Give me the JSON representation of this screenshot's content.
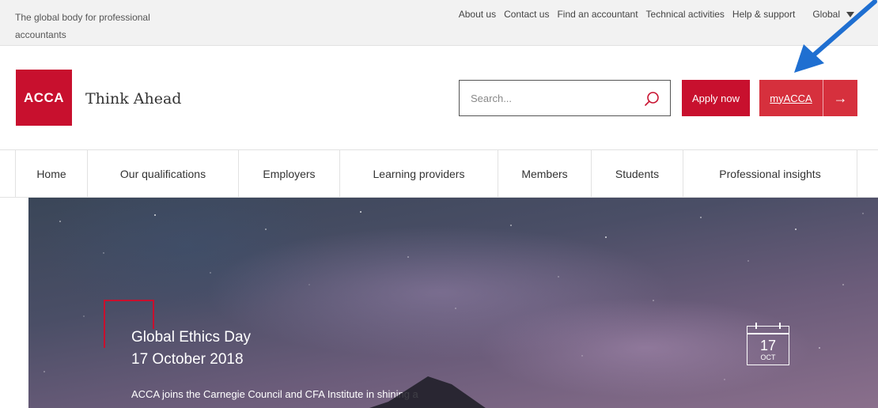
{
  "topbar": {
    "tagline": "The global body for professional accountants",
    "links": [
      "About us",
      "Contact us",
      "Find an accountant",
      "Technical activities",
      "Help & support"
    ],
    "region": "Global"
  },
  "header": {
    "logo_text": "ACCA",
    "slogan": "Think Ahead",
    "search_placeholder": "Search...",
    "apply_label": "Apply now",
    "myacca_label": "myACCA",
    "myacca_arrow": "→"
  },
  "nav": {
    "items": [
      "Home",
      "Our qualifications",
      "Employers",
      "Learning providers",
      "Members",
      "Students",
      "Professional insights"
    ]
  },
  "hero": {
    "title_line1": "Global Ethics Day",
    "title_line2": "17 October 2018",
    "description": "ACCA joins the Carnegie Council and CFA Institute in shining a",
    "calendar_day": "17",
    "calendar_month": "OCT"
  },
  "colors": {
    "brand_red": "#c8102e",
    "myacca_red": "#d6303d",
    "annotation_blue": "#1f6fd1"
  }
}
